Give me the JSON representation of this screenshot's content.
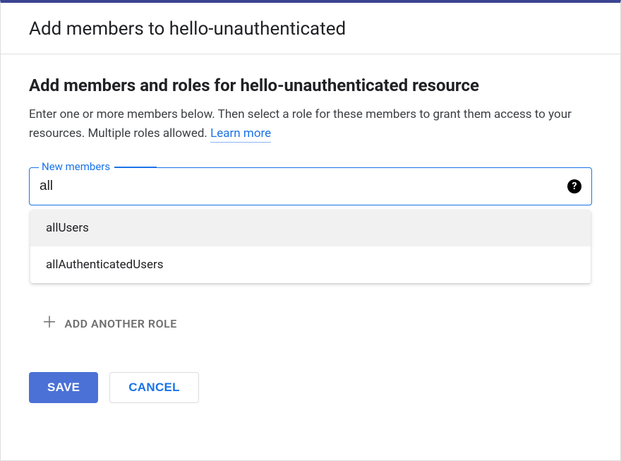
{
  "panel": {
    "title": "Add members to hello-unauthenticated"
  },
  "section": {
    "heading": "Add members and roles for hello-unauthenticated resource",
    "description": "Enter one or more members below. Then select a role for these members to grant them access to your resources. Multiple roles allowed. ",
    "learn_more": "Learn more"
  },
  "members_field": {
    "label": "New members",
    "value": "all",
    "help_icon": "?",
    "suggestions": [
      {
        "label": "allUsers",
        "highlighted": true
      },
      {
        "label": "allAuthenticatedUsers",
        "highlighted": false
      }
    ]
  },
  "add_role": {
    "label": "Add Another Role"
  },
  "actions": {
    "save": "SAVE",
    "cancel": "CANCEL"
  }
}
